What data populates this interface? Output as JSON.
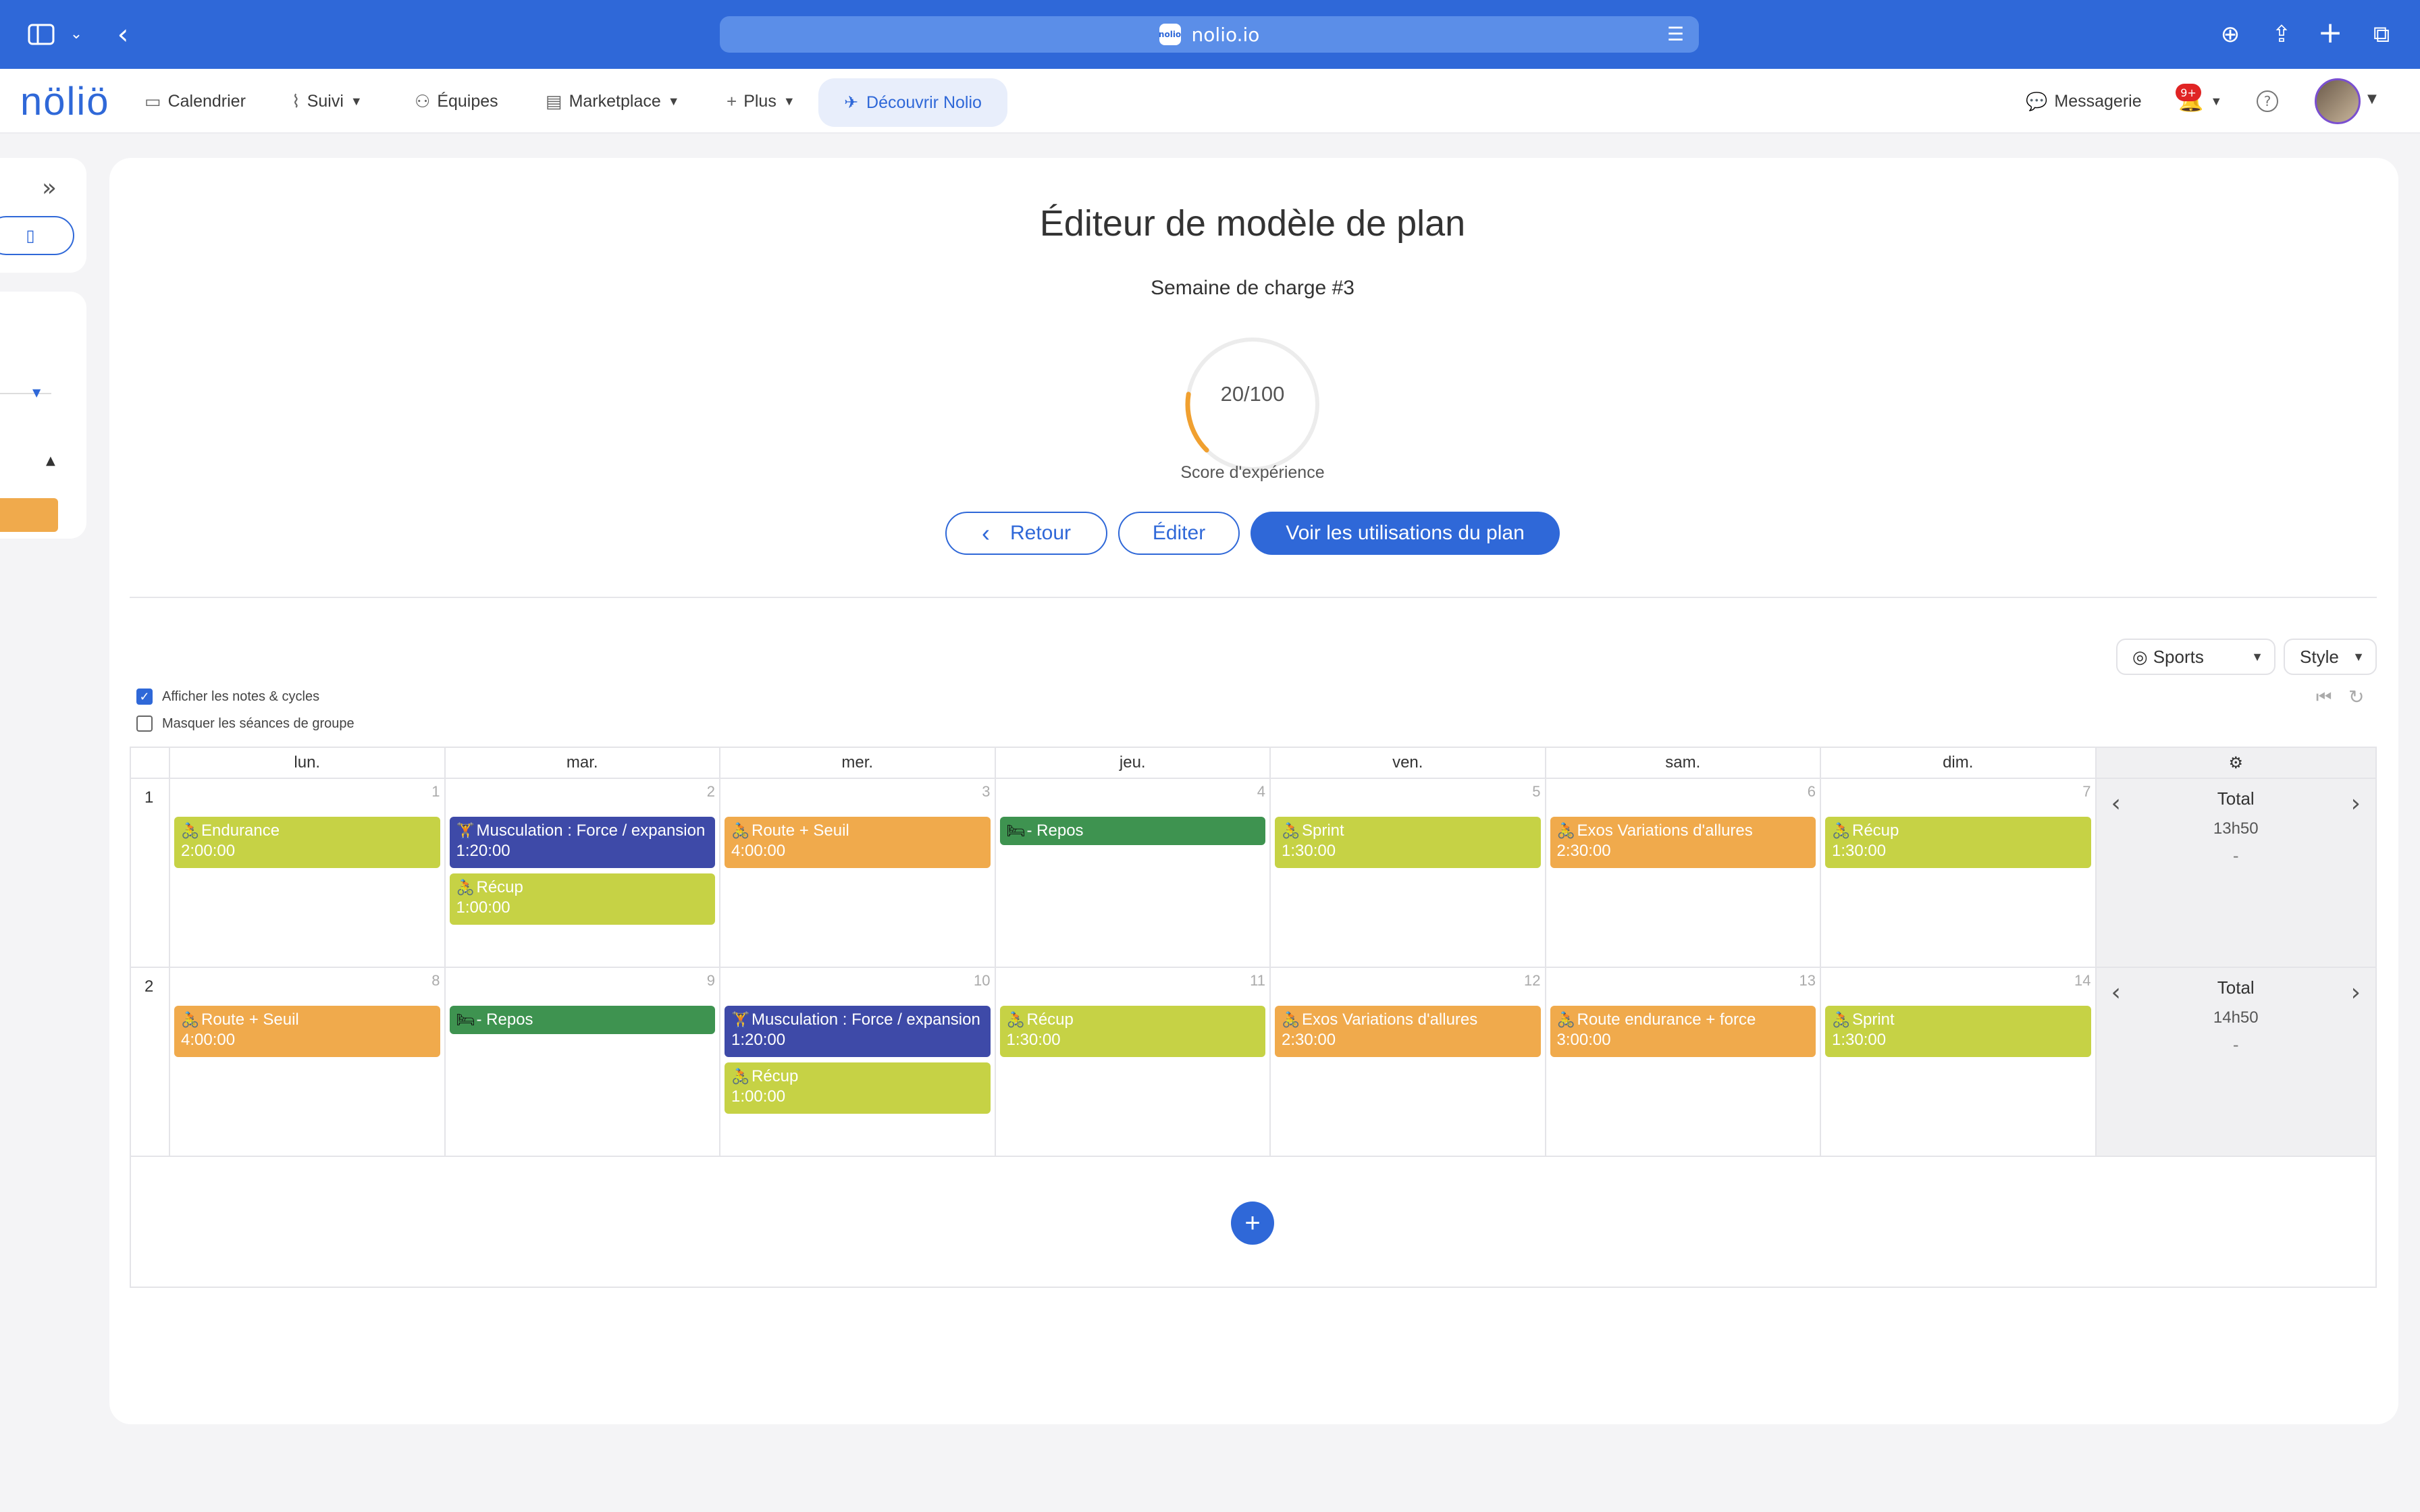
{
  "browser": {
    "url": "nolio.io",
    "favicon_text": "nolio"
  },
  "nav": {
    "logo": "nöliö",
    "items": [
      {
        "label": "Calendrier",
        "icon": "calendar-icon"
      },
      {
        "label": "Suivi",
        "icon": "chart-icon"
      },
      {
        "label": "Équipes",
        "icon": "team-icon"
      },
      {
        "label": "Marketplace",
        "icon": "store-icon"
      },
      {
        "label": "Plus",
        "icon": "plus-icon"
      }
    ],
    "discover": "Découvrir Nolio",
    "messages": "Messagerie",
    "notif_badge": "9+"
  },
  "page": {
    "title": "Éditeur de modèle de plan",
    "subtitle": "Semaine de charge #3",
    "score": {
      "value": 20,
      "max": 100,
      "text": "20/100",
      "label": "Score d'expérience"
    },
    "buttons": {
      "back": "Retour",
      "edit": "Éditer",
      "usages": "Voir les utilisations du plan"
    }
  },
  "controls": {
    "sports": "Sports",
    "style": "Style",
    "show_notes": {
      "label": "Afficher les notes & cycles",
      "checked": true
    },
    "hide_group": {
      "label": "Masquer les séances de groupe",
      "checked": false
    }
  },
  "calendar": {
    "days": [
      "lun.",
      "mar.",
      "mer.",
      "jeu.",
      "ven.",
      "sam.",
      "dim."
    ],
    "weeks": [
      {
        "number": "1",
        "total_label": "Total",
        "total_value": "13h50",
        "total_extra": "-",
        "days": [
          {
            "date": "1",
            "events": [
              {
                "title": "Endurance",
                "time": "2:00:00",
                "type": "bike",
                "color": "#c6d245"
              }
            ]
          },
          {
            "date": "2",
            "events": [
              {
                "title": "Musculation : Force / expansion",
                "time": "1:20:00",
                "type": "gym",
                "color": "#3e4aa8"
              },
              {
                "title": "Récup",
                "time": "1:00:00",
                "type": "bike",
                "color": "#c6d245"
              }
            ]
          },
          {
            "date": "3",
            "events": [
              {
                "title": "Route + Seuil",
                "time": "4:00:00",
                "type": "bike",
                "color": "#f0aa4c"
              }
            ]
          },
          {
            "date": "4",
            "events": [
              {
                "title": "- Repos",
                "time": "",
                "type": "rest",
                "color": "#3e9350"
              }
            ]
          },
          {
            "date": "5",
            "events": [
              {
                "title": "Sprint",
                "time": "1:30:00",
                "type": "bike",
                "color": "#c6d245"
              }
            ]
          },
          {
            "date": "6",
            "events": [
              {
                "title": "Exos Variations d'allures",
                "time": "2:30:00",
                "type": "bike",
                "color": "#f0aa4c"
              }
            ]
          },
          {
            "date": "7",
            "events": [
              {
                "title": "Récup",
                "time": "1:30:00",
                "type": "bike",
                "color": "#c6d245"
              }
            ]
          }
        ]
      },
      {
        "number": "2",
        "total_label": "Total",
        "total_value": "14h50",
        "total_extra": "-",
        "days": [
          {
            "date": "8",
            "events": [
              {
                "title": "Route + Seuil",
                "time": "4:00:00",
                "type": "bike",
                "color": "#f0aa4c"
              }
            ]
          },
          {
            "date": "9",
            "events": [
              {
                "title": "- Repos",
                "time": "",
                "type": "rest",
                "color": "#3e9350"
              }
            ]
          },
          {
            "date": "10",
            "events": [
              {
                "title": "Musculation : Force / expansion",
                "time": "1:20:00",
                "type": "gym",
                "color": "#3e4aa8"
              },
              {
                "title": "Récup",
                "time": "1:00:00",
                "type": "bike",
                "color": "#c6d245"
              }
            ]
          },
          {
            "date": "11",
            "events": [
              {
                "title": "Récup",
                "time": "1:30:00",
                "type": "bike",
                "color": "#c6d245"
              }
            ]
          },
          {
            "date": "12",
            "events": [
              {
                "title": "Exos Variations d'allures",
                "time": "2:30:00",
                "type": "bike",
                "color": "#f0aa4c"
              }
            ]
          },
          {
            "date": "13",
            "events": [
              {
                "title": "Route endurance + force",
                "time": "3:00:00",
                "type": "bike",
                "color": "#f0aa4c"
              }
            ]
          },
          {
            "date": "14",
            "events": [
              {
                "title": "Sprint",
                "time": "1:30:00",
                "type": "bike",
                "color": "#c6d245"
              }
            ]
          }
        ]
      }
    ]
  }
}
